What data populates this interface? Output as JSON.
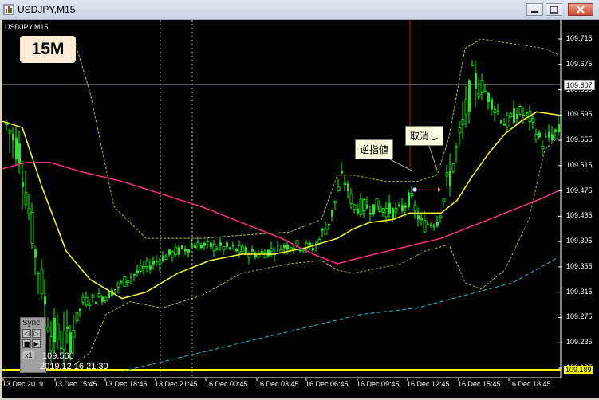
{
  "window": {
    "title": "USDJPY,M15"
  },
  "chart": {
    "symbol_label": "USDJPY,M15",
    "timeframe_badge": "15M",
    "annotations": {
      "stop_order": "逆指値",
      "cancel": "取消し"
    },
    "sync_panel": {
      "title": "Sync",
      "speed": "x1"
    },
    "readout": {
      "price": "109.560",
      "datetime": "2019.12.16 21:30"
    },
    "y_axis_labels": [
      "109.715",
      "109.675",
      "109.635",
      "109.595",
      "109.555",
      "109.515",
      "109.475",
      "109.435",
      "109.395",
      "109.355",
      "109.315",
      "109.275",
      "109.235",
      "109.195"
    ],
    "current_price_label": "109.607",
    "bid_price_label": "109.189",
    "x_axis_labels": [
      "13 Dec 2019",
      "13 Dec 15:45",
      "13 Dec 18:45",
      "13 Dec 21:45",
      "16 Dec 00:45",
      "16 Dec 03:45",
      "16 Dec 06:45",
      "16 Dec 09:45",
      "16 Dec 12:45",
      "16 Dec 15:45",
      "16 Dec 18:45"
    ],
    "colors": {
      "background": "#000000",
      "bull_candle": "#00ff00",
      "ma_short": "#ffff33",
      "ma_long": "#ff2d8a",
      "ma_very_long": "#1fa3b5",
      "band": "#b5b52a"
    }
  }
}
